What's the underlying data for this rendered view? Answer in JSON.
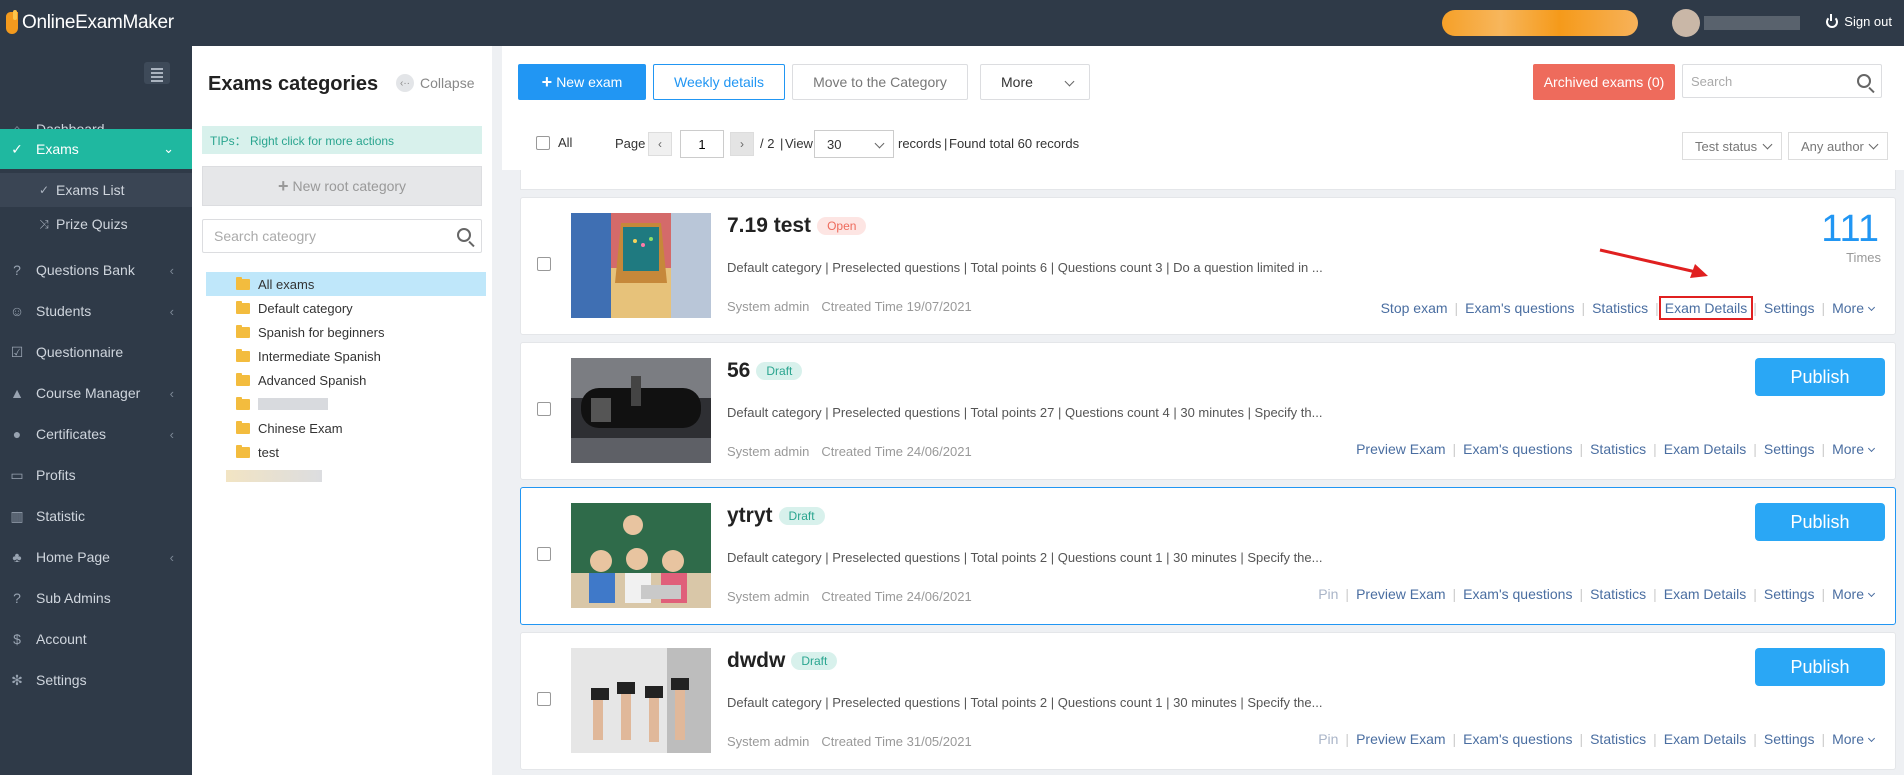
{
  "app": {
    "logo_text": "OnlineExamMaker",
    "sign_out": "Sign out"
  },
  "sidebar": {
    "items": [
      {
        "label": "Dashboard",
        "icon": "home-icon",
        "glyph": "⌂"
      },
      {
        "label": "Exams",
        "icon": "check-circle-icon",
        "glyph": "✓",
        "active": true
      },
      {
        "label": "Questions Bank",
        "icon": "question-icon",
        "glyph": "?"
      },
      {
        "label": "Students",
        "icon": "user-icon",
        "glyph": "☺"
      },
      {
        "label": "Questionnaire",
        "icon": "checkbox-icon",
        "glyph": "☑"
      },
      {
        "label": "Course Manager",
        "icon": "graduation-cap-icon",
        "glyph": "▲"
      },
      {
        "label": "Certificates",
        "icon": "certificate-icon",
        "glyph": "●"
      },
      {
        "label": "Profits",
        "icon": "credit-card-icon",
        "glyph": "▭"
      },
      {
        "label": "Statistic",
        "icon": "bar-chart-icon",
        "glyph": "▥"
      },
      {
        "label": "Home Page",
        "icon": "tree-icon",
        "glyph": "♣"
      },
      {
        "label": "Sub Admins",
        "icon": "sub-admin-icon",
        "glyph": "?"
      },
      {
        "label": "Account",
        "icon": "dollar-icon",
        "glyph": "$"
      },
      {
        "label": "Settings",
        "icon": "gear-icon",
        "glyph": "✻"
      }
    ],
    "sub_items": [
      {
        "label": "Exams List",
        "icon": "check-circle-icon",
        "glyph": "✓"
      },
      {
        "label": "Prize Quizs",
        "icon": "shuffle-icon",
        "glyph": "⤨"
      }
    ]
  },
  "categories": {
    "title": "Exams categories",
    "collapse": "Collapse",
    "tips": "TIPs： Right click for more actions",
    "new_root": "New root category",
    "search_placeholder": "Search cateogry",
    "tree": [
      "All exams",
      "Default category",
      "Spanish for beginners",
      "Intermediate Spanish",
      "Advanced Spanish",
      "",
      "Chinese Exam",
      "test"
    ]
  },
  "toolbar": {
    "new_exam": "New exam",
    "weekly_details": "Weekly details",
    "move_to_category": "Move to the Category",
    "more": "More",
    "archived": "Archived exams (0)",
    "search_placeholder": "Search"
  },
  "pager": {
    "all": "All",
    "page": "Page",
    "current": "1",
    "total_pages": "/ 2",
    "view": "View",
    "per_page": "30",
    "records": "records",
    "found": "Found total 60 records",
    "test_status": "Test status",
    "any_author": "Any author"
  },
  "exams": [
    {
      "title": "7.19 test",
      "status": "Open",
      "desc": "Default category | Preselected questions | Total points 6 | Questions count 3 | Do a question limited in ...",
      "author": "System admin",
      "created": "Ctreated Time 19/07/2021",
      "times": "111",
      "times_label": "Times",
      "actions": [
        "Stop exam",
        "Exam's questions",
        "Statistics",
        "Exam Details",
        "Settings",
        "More"
      ]
    },
    {
      "title": "56",
      "status": "Draft",
      "desc": "Default category | Preselected questions | Total points 27 | Questions count 4 | 30 minutes | Specify th...",
      "author": "System admin",
      "created": "Ctreated Time 24/06/2021",
      "publish": "Publish",
      "actions": [
        "Preview Exam",
        "Exam's questions",
        "Statistics",
        "Exam Details",
        "Settings",
        "More"
      ]
    },
    {
      "title": "ytryt",
      "status": "Draft",
      "desc": "Default category | Preselected questions | Total points 2 | Questions count 1 | 30 minutes | Specify the...",
      "author": "System admin",
      "created": "Ctreated Time 24/06/2021",
      "publish": "Publish",
      "actions": [
        "Pin",
        "Preview Exam",
        "Exam's questions",
        "Statistics",
        "Exam Details",
        "Settings",
        "More"
      ]
    },
    {
      "title": "dwdw",
      "status": "Draft",
      "desc": "Default category | Preselected questions | Total points 2 | Questions count 1 | 30 minutes | Specify the...",
      "author": "System admin",
      "created": "Ctreated Time 31/05/2021",
      "publish": "Publish",
      "actions": [
        "Pin",
        "Preview Exam",
        "Exam's questions",
        "Statistics",
        "Exam Details",
        "Settings",
        "More"
      ]
    }
  ],
  "colors": {
    "accent": "#1fb8a0",
    "primary": "#2196f3",
    "danger": "#ee6b5c",
    "sidebar": "#2f3a48",
    "highlight_box": "#e02020"
  }
}
